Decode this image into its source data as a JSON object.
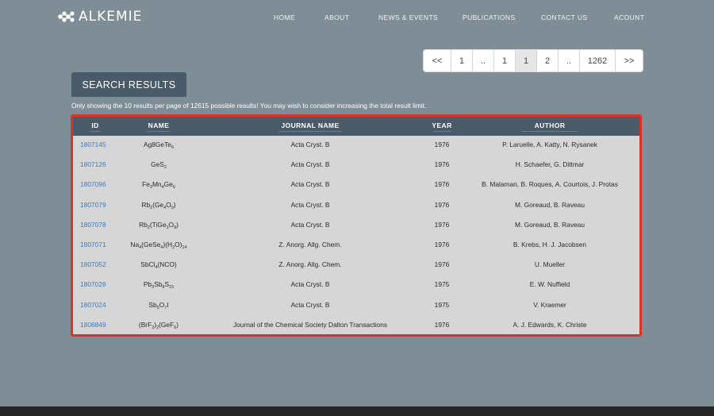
{
  "brand": {
    "name": "ALKEMIE"
  },
  "nav": {
    "items": [
      "HOME",
      "ABOUT",
      "NEWS & EVENTS",
      "PUBLICATIONS",
      "CONTACT US",
      "ACOUNT"
    ]
  },
  "pagination": {
    "buttons": [
      "<<",
      "1",
      "..",
      "1",
      "1",
      "2",
      "..",
      "1262",
      ">>"
    ],
    "active_index": 4
  },
  "results": {
    "tab_label": "SEARCH RESULTS",
    "notice": "Only showing the 10 results per page of 12615 possible results! You may wish to consider increasing the total result limit.",
    "columns": [
      "ID",
      "NAME",
      "JOURNAL NAME",
      "YEAR",
      "AUTHOR"
    ],
    "rows": [
      {
        "id": "1807145",
        "name": [
          [
            "Ag",
            ""
          ],
          [
            "8",
            ""
          ],
          [
            "GeTe",
            ""
          ],
          [
            "6",
            "sub"
          ]
        ],
        "journal": "Acta Cryst. B",
        "year": "1976",
        "author": "P. Laruelle, A. Katty, N. Rysanek"
      },
      {
        "id": "1807126",
        "name": [
          [
            "GeS",
            ""
          ],
          [
            "2",
            "sub"
          ]
        ],
        "journal": "Acta Cryst. B",
        "year": "1976",
        "author": "H. Schaefer, G. Dittmar"
      },
      {
        "id": "1807096",
        "name": [
          [
            "Fe",
            ""
          ],
          [
            "3",
            "sub"
          ],
          [
            "Mn",
            ""
          ],
          [
            "4",
            "sub"
          ],
          [
            "Ge",
            ""
          ],
          [
            "6",
            "sub"
          ]
        ],
        "journal": "Acta Cryst. B",
        "year": "1976",
        "author": "B. Malaman, B. Roques, A. Courtois, J. Protas"
      },
      {
        "id": "1807079",
        "name": [
          [
            "Rb",
            ""
          ],
          [
            "2",
            "sub"
          ],
          [
            "(Ge",
            ""
          ],
          [
            "4",
            "sub"
          ],
          [
            "O",
            ""
          ],
          [
            "9",
            "sub"
          ],
          [
            ")",
            ""
          ]
        ],
        "journal": "Acta Cryst. B",
        "year": "1976",
        "author": "M. Goreaud, B. Raveau"
      },
      {
        "id": "1807078",
        "name": [
          [
            "Rb",
            ""
          ],
          [
            "2",
            "sub"
          ],
          [
            "(TiGe",
            ""
          ],
          [
            "3",
            "sub"
          ],
          [
            "O",
            ""
          ],
          [
            "9",
            "sub"
          ],
          [
            ")",
            ""
          ]
        ],
        "journal": "Acta Cryst. B",
        "year": "1976",
        "author": "M. Goreaud, B. Raveau"
      },
      {
        "id": "1807071",
        "name": [
          [
            "Na",
            ""
          ],
          [
            "4",
            "sub"
          ],
          [
            "(GeSe",
            ""
          ],
          [
            "4",
            "sub"
          ],
          [
            ")(H",
            ""
          ],
          [
            "2",
            "sub"
          ],
          [
            "O)",
            ""
          ],
          [
            "14",
            "sub"
          ]
        ],
        "journal": "Z. Anorg. Allg. Chem.",
        "year": "1976",
        "author": "B. Krebs, H. J. Jacobsen"
      },
      {
        "id": "1807052",
        "name": [
          [
            "SbCl",
            ""
          ],
          [
            "4",
            "sub"
          ],
          [
            "(NCO)",
            ""
          ]
        ],
        "journal": "Z. Anorg. Allg. Chem.",
        "year": "1976",
        "author": "U. Mueller"
      },
      {
        "id": "1807028",
        "name": [
          [
            "Pb",
            ""
          ],
          [
            "3",
            "sub"
          ],
          [
            "Sb",
            ""
          ],
          [
            "8",
            "sub"
          ],
          [
            "S",
            ""
          ],
          [
            "15",
            "sub"
          ]
        ],
        "journal": "Acta Cryst. B",
        "year": "1975",
        "author": "E. W. Nuffield"
      },
      {
        "id": "1807024",
        "name": [
          [
            "Sb",
            ""
          ],
          [
            "5",
            "sub"
          ],
          [
            "O",
            ""
          ],
          [
            "7",
            "sub"
          ],
          [
            "I",
            ""
          ]
        ],
        "journal": "Acta Cryst. B",
        "year": "1975",
        "author": "V. Kraemer"
      },
      {
        "id": "1806849",
        "name": [
          [
            "(BrF",
            ""
          ],
          [
            "2",
            "sub"
          ],
          [
            ")",
            ""
          ],
          [
            "2",
            "sub"
          ],
          [
            "(GeF",
            ""
          ],
          [
            "6",
            "sub"
          ],
          [
            ")",
            ""
          ]
        ],
        "journal": "Journal of the Chemical Society Dalton Transactions",
        "year": "1976",
        "author": "A. J. Edwards, K. Christe"
      }
    ]
  },
  "colors": {
    "background": "#7f8d96",
    "header_bar": "#495b68",
    "highlight_border": "#d9322b",
    "link": "#3b7bc0"
  }
}
